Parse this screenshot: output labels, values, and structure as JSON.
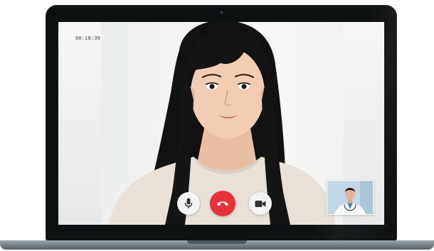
{
  "call": {
    "elapsed_time": "00:10:38"
  },
  "controls": [
    {
      "name": "mute-microphone-button",
      "icon": "microphone-icon"
    },
    {
      "name": "end-call-button",
      "icon": "phone-hang-up-icon"
    },
    {
      "name": "toggle-video-button",
      "icon": "video-camera-icon"
    }
  ],
  "colors": {
    "end_call": "#e8323b",
    "control_bg": "#f4f4f4",
    "laptop_bezel": "#0e1112"
  }
}
